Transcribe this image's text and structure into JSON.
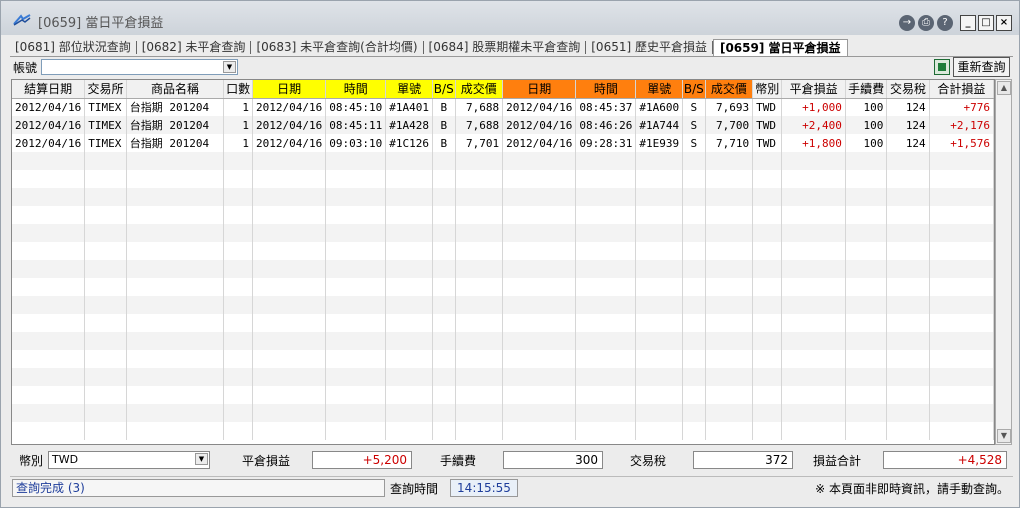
{
  "window": {
    "title": "[0659] 當日平倉損益",
    "icons": [
      "app-logo-icon",
      "export-icon",
      "print-icon",
      "help-icon",
      "minimize-icon",
      "maximize-icon",
      "close-icon"
    ]
  },
  "tabs": [
    {
      "label": "[0681] 部位狀況查詢",
      "active": false
    },
    {
      "label": "[0682] 未平倉查詢",
      "active": false
    },
    {
      "label": "[0683] 未平倉查詢(合計均價)",
      "active": false
    },
    {
      "label": "[0684] 股票期權未平倉查詢",
      "active": false
    },
    {
      "label": "[0651] 歷史平倉損益",
      "active": false
    },
    {
      "label": "[0659] 當日平倉損益",
      "active": true
    }
  ],
  "toolbar": {
    "account_label": "帳號",
    "account_value": "",
    "requery_label": "重新查詢"
  },
  "table": {
    "headers": [
      "結算日期",
      "交易所",
      "商品名稱",
      "口數",
      "日期",
      "時間",
      "單號",
      "B/S",
      "成交價",
      "日期",
      "時間",
      "單號",
      "B/S",
      "成交價",
      "幣別",
      "平倉損益",
      "手續費",
      "交易稅",
      "合計損益"
    ],
    "rows": [
      [
        "2012/04/16",
        "TIMEX",
        "台指期 201204",
        "1",
        "2012/04/16",
        "08:45:10",
        "#1A401",
        "B",
        "7,688",
        "2012/04/16",
        "08:45:37",
        "#1A600",
        "S",
        "7,693",
        "TWD",
        "+1,000",
        "100",
        "124",
        "+776"
      ],
      [
        "2012/04/16",
        "TIMEX",
        "台指期 201204",
        "1",
        "2012/04/16",
        "08:45:11",
        "#1A428",
        "B",
        "7,688",
        "2012/04/16",
        "08:46:26",
        "#1A744",
        "S",
        "7,700",
        "TWD",
        "+2,400",
        "100",
        "124",
        "+2,176"
      ],
      [
        "2012/04/16",
        "TIMEX",
        "台指期 201204",
        "1",
        "2012/04/16",
        "09:03:10",
        "#1C126",
        "B",
        "7,701",
        "2012/04/16",
        "09:28:31",
        "#1E939",
        "S",
        "7,710",
        "TWD",
        "+1,800",
        "100",
        "124",
        "+1,576"
      ]
    ]
  },
  "summary": {
    "currency_label": "幣別",
    "currency_value": "TWD",
    "pnl_label": "平倉損益",
    "pnl_value": "+5,200",
    "fee_label": "手續費",
    "fee_value": "300",
    "tax_label": "交易稅",
    "tax_value": "372",
    "total_label": "損益合計",
    "total_value": "+4,528"
  },
  "status": {
    "text": "查詢完成 (3)",
    "query_time_label": "查詢時間",
    "query_time": "14:15:55",
    "notice": "※ 本頁面非即時資訊，請手動查詢。"
  },
  "colors": {
    "buy_header": "#ffff00",
    "sell_header": "#ff7f0e",
    "profit": "#cc0000",
    "status_text": "#1f3e9b"
  }
}
